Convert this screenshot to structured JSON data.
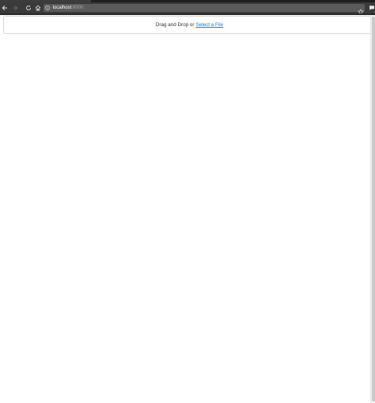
{
  "browser": {
    "url_host": "localhost",
    "url_port": ":8000",
    "icons": {
      "back": "back-arrow-icon",
      "forward": "forward-arrow-icon",
      "reload": "reload-icon",
      "home": "home-icon",
      "info": "info-icon",
      "star": "bookmark-star-icon",
      "menu": "chat-bubble-icon"
    }
  },
  "dropzone": {
    "prompt": "Drag and Drop or",
    "link_label": "Select a File",
    "link_color": "#1f7ed6"
  }
}
